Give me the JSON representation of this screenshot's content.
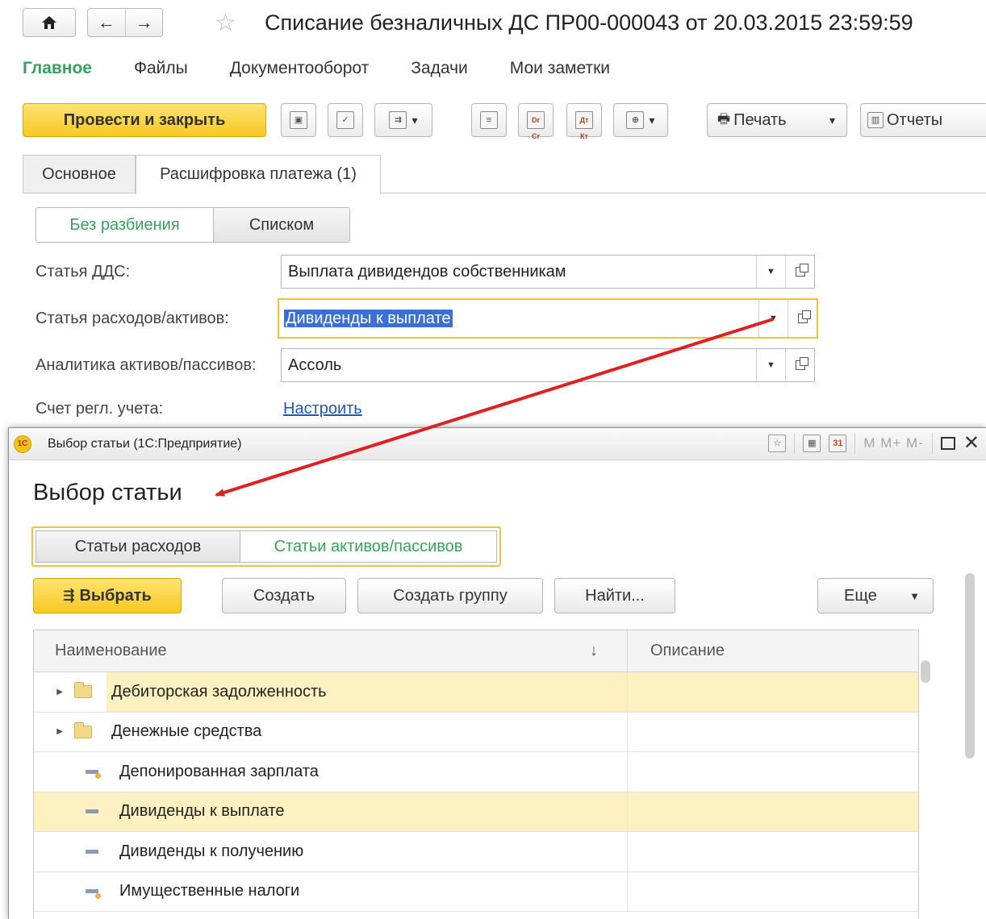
{
  "header": {
    "title": "Списание безналичных ДС ПР00-000043 от 20.03.2015 23:59:59",
    "home_icon": "home-icon",
    "back_icon": "arrow-left-icon",
    "forward_icon": "arrow-right-icon",
    "star_icon": "star-icon"
  },
  "sections": [
    "Главное",
    "Файлы",
    "Документооборот",
    "Задачи",
    "Мои заметки"
  ],
  "toolbar": {
    "post_close": "Провести и закрыть",
    "dr_cr": "Dr Cr",
    "dt_kt": "Дт Кт",
    "print": "Печать",
    "reports": "Отчеты"
  },
  "tabs": [
    "Основное",
    "Расшифровка платежа (1)"
  ],
  "split": {
    "no_split": "Без разбиения",
    "list": "Списком"
  },
  "fields": {
    "dds_label": "Статья ДДС:",
    "dds_value": "Выплата дивидендов собственникам",
    "expense_label": "Статья расходов/активов:",
    "expense_value": "Дивиденды к выплате",
    "analytics_label": "Аналитика активов/пассивов:",
    "analytics_value": "Ассоль",
    "account_label": "Счет регл. учета:",
    "account_link": "Настроить"
  },
  "popup": {
    "window_title": "Выбор статьи  (1С:Предприятие)",
    "logo_text": "1С",
    "memory": "M  M+  M-",
    "heading": "Выбор статьи",
    "seg_expenses": "Статьи расходов",
    "seg_assets": "Статьи активов/пассивов",
    "btn_select": "Выбрать",
    "btn_create": "Создать",
    "btn_create_group": "Создать группу",
    "btn_find": "Найти...",
    "btn_more": "Еще",
    "col_name": "Наименование",
    "col_desc": "Описание",
    "sort_icon": "↓",
    "rows": [
      {
        "name": "Дебиторская задолженность",
        "type": "folder"
      },
      {
        "name": "Денежные средства",
        "type": "folder"
      },
      {
        "name": "Депонированная зарплата",
        "type": "item-tax"
      },
      {
        "name": "Дивиденды к выплате",
        "type": "item"
      },
      {
        "name": "Дивиденды к получению",
        "type": "item"
      },
      {
        "name": "Имущественные налоги",
        "type": "item-tax"
      }
    ]
  },
  "colors": {
    "accent_green": "#36a25b",
    "button_yellow": "#f7c823",
    "focus_border": "#f1c232",
    "row_highlight": "#fdf1c2",
    "link_blue": "#2456b5",
    "annotation_arrow": "#e02020"
  }
}
